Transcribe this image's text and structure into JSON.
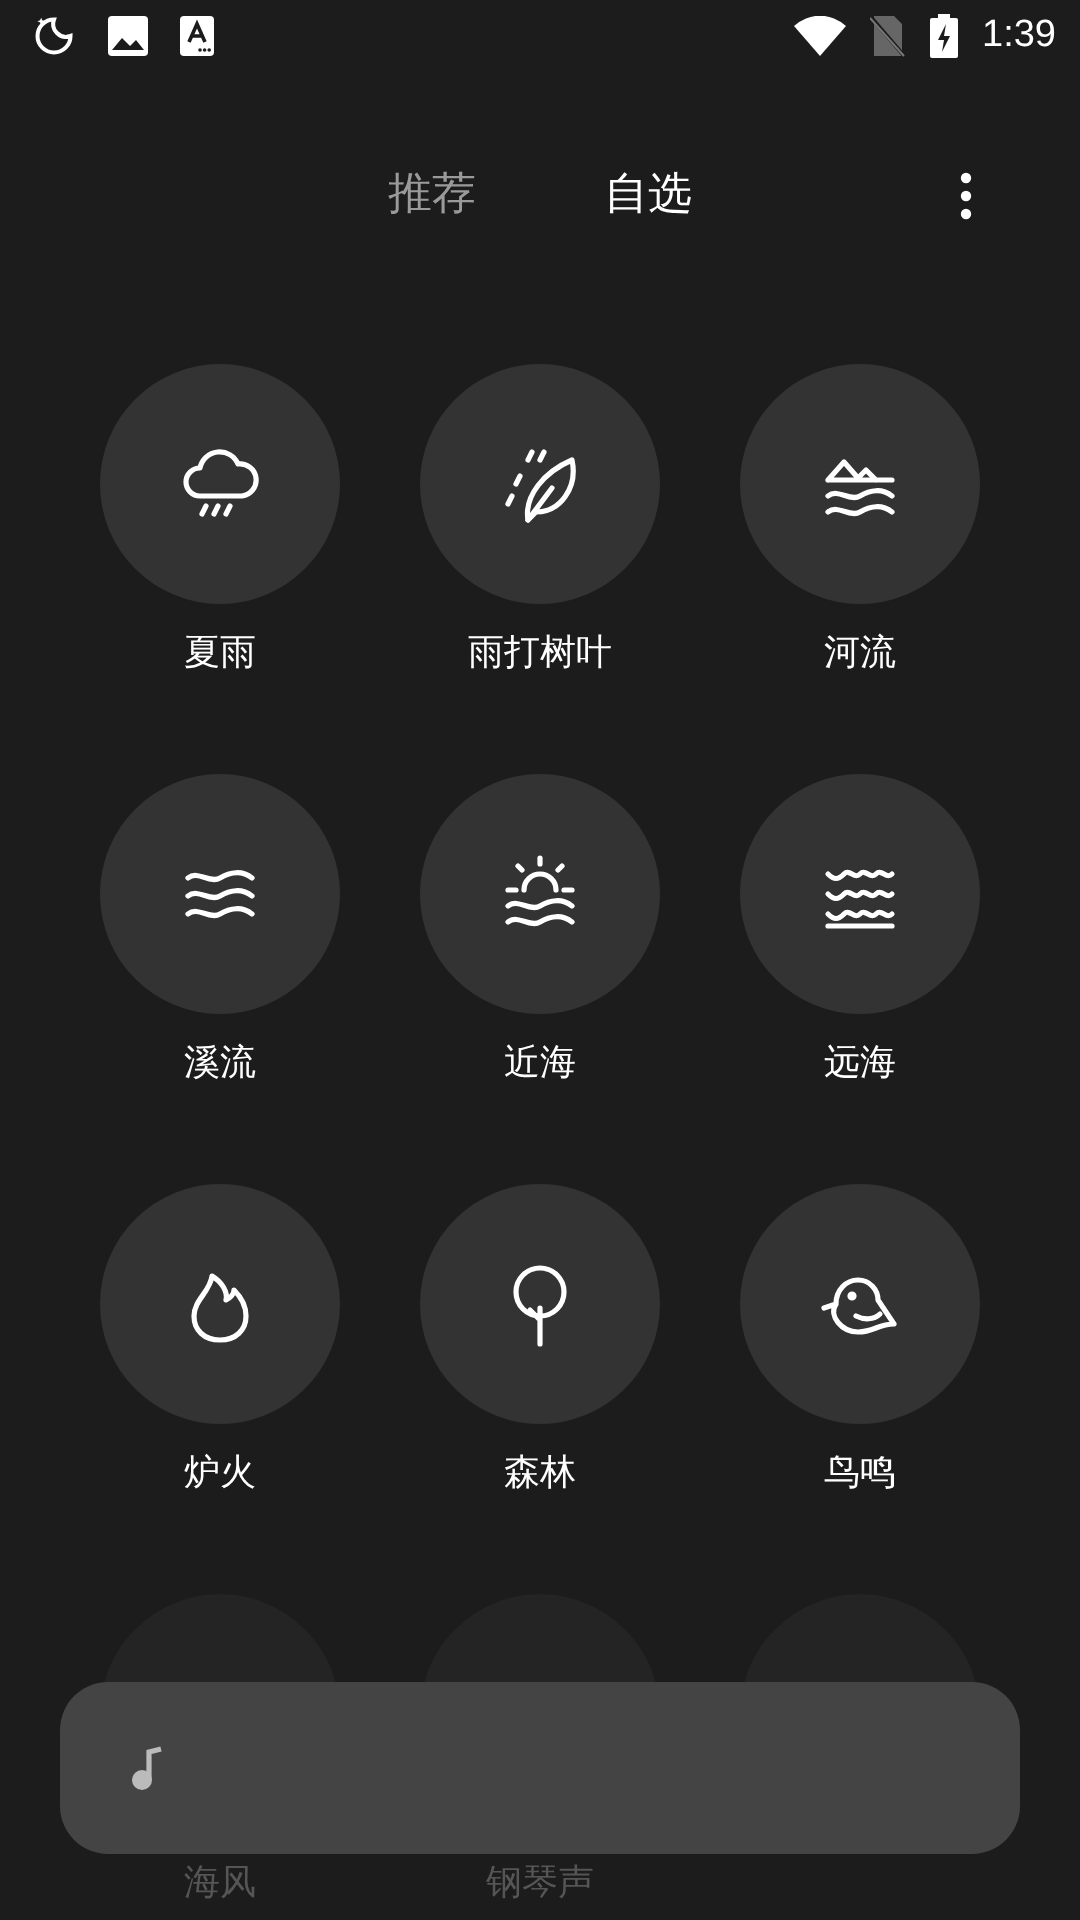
{
  "status_bar": {
    "time": "1:39"
  },
  "tabs": [
    {
      "label": "推荐",
      "selected": false
    },
    {
      "label": "自选",
      "selected": true
    }
  ],
  "sounds": [
    {
      "label": "夏雨",
      "kind": "rain",
      "dim": false
    },
    {
      "label": "雨打树叶",
      "kind": "leaf",
      "dim": false
    },
    {
      "label": "河流",
      "kind": "river",
      "dim": false
    },
    {
      "label": "溪流",
      "kind": "stream",
      "dim": false
    },
    {
      "label": "近海",
      "kind": "sea",
      "dim": false
    },
    {
      "label": "远海",
      "kind": "ocean",
      "dim": false
    },
    {
      "label": "炉火",
      "kind": "fire",
      "dim": false
    },
    {
      "label": "森林",
      "kind": "tree",
      "dim": false
    },
    {
      "label": "鸟鸣",
      "kind": "bird",
      "dim": false
    },
    {
      "label": "海风",
      "dim": true
    },
    {
      "label": "钢琴声",
      "dim": true
    },
    {
      "dim": true
    }
  ]
}
